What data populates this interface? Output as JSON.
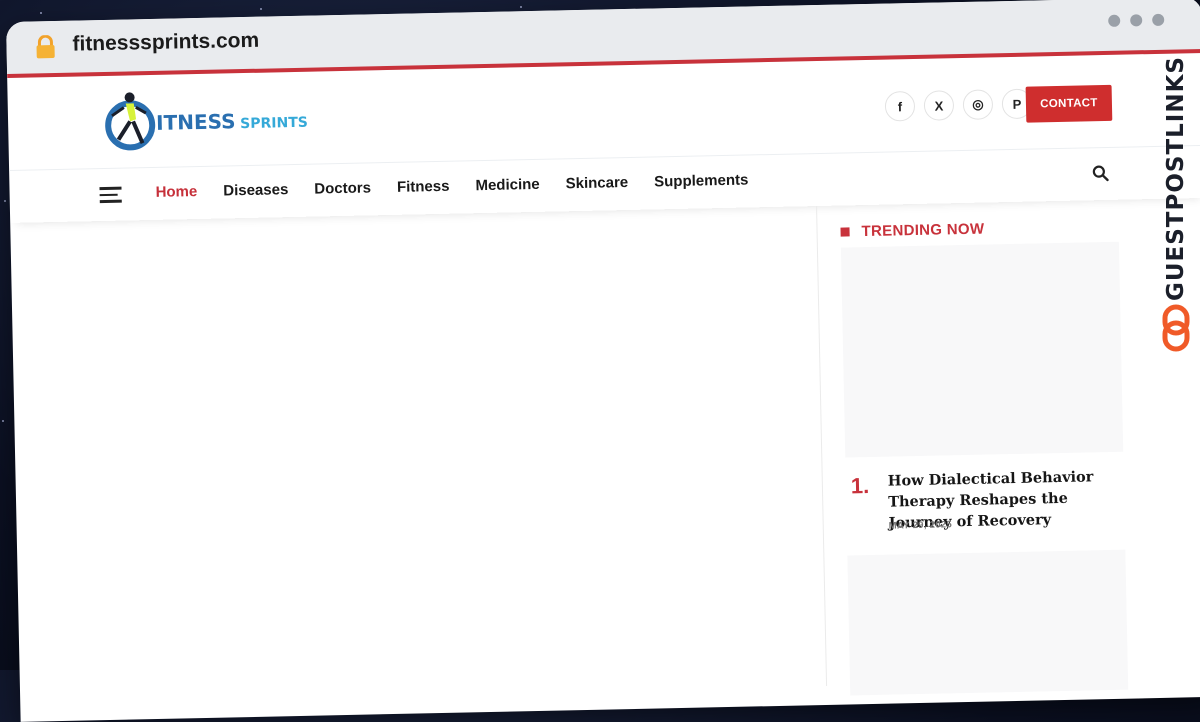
{
  "browser": {
    "url": "fitnesssprints.com"
  },
  "site": {
    "logo": {
      "text_main": "ITNESS",
      "text_sub": "SPRINTS"
    },
    "header": {
      "contact_label": "CONTACT",
      "socials": [
        {
          "name": "facebook-icon",
          "glyph": "f"
        },
        {
          "name": "x-twitter-icon",
          "glyph": "X"
        },
        {
          "name": "instagram-icon",
          "glyph": "◎"
        },
        {
          "name": "pinterest-icon",
          "glyph": "P"
        }
      ]
    },
    "nav": {
      "items": [
        "Home",
        "Diseases",
        "Doctors",
        "Fitness",
        "Medicine",
        "Skincare",
        "Supplements"
      ],
      "active": "Home"
    },
    "sidebar": {
      "title": "TRENDING NOW",
      "articles": [
        {
          "rank": "1.",
          "title": "How Dialectical Behavior Therapy Reshapes the Journey of Recovery",
          "date": "MAY 29, 2025"
        }
      ]
    }
  },
  "watermark": {
    "text": "GUESTPOSTLINKS"
  },
  "colors": {
    "accent": "#c8323b",
    "contact_button": "#cf2e2e",
    "logo_blue": "#2a6fb0",
    "logo_cyan": "#35a9d8",
    "watermark_orange": "#f05a28"
  }
}
